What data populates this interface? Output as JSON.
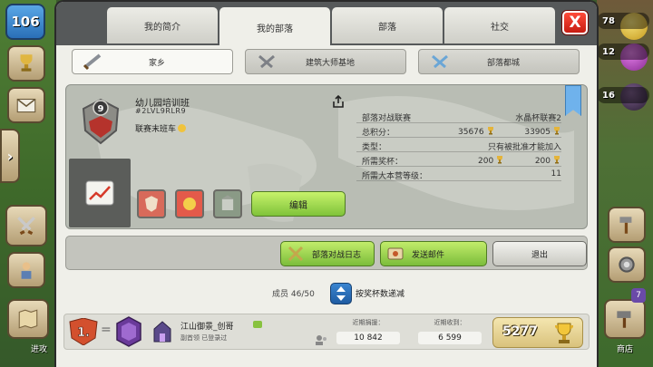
{
  "hud": {
    "player_level": "106",
    "left_labels": {
      "attack": "进攻"
    },
    "right_resources": [
      "78",
      "12",
      "16"
    ],
    "shop_label": "商店",
    "shop_badge": "7"
  },
  "tabs": [
    {
      "label": "我的简介",
      "active": false
    },
    {
      "label": "我的部落",
      "active": true
    },
    {
      "label": "部落",
      "active": false
    },
    {
      "label": "社交",
      "active": false
    }
  ],
  "close_label": "X",
  "subtabs": [
    {
      "label": "家乡",
      "icon": "sword-icon",
      "active": true
    },
    {
      "label": "建筑大师基地",
      "icon": "hammer-icon",
      "active": false
    },
    {
      "label": "部落都城",
      "icon": "crossed-swords-icon",
      "active": false
    }
  ],
  "clan": {
    "level": "9",
    "name": "幼儿园培训班",
    "tag": "#2LVL9RLR9",
    "league_label": "联赛末班车"
  },
  "stats": [
    {
      "label": "部落对战联赛",
      "value": "水晶杯联赛2"
    },
    {
      "label": "总积分：",
      "value_a": "35676",
      "value_b": "33905"
    },
    {
      "label": "类型：",
      "value": "只有被批准才能加入"
    },
    {
      "label": "所需奖杯：",
      "value_a": "200",
      "value_b": "200"
    },
    {
      "label": "所需大本营等级：",
      "value": "11"
    }
  ],
  "edit_label": "编辑",
  "actions": {
    "war_log": "部落对战日志",
    "send_mail": "发送邮件",
    "leave": "退出"
  },
  "members_header": {
    "count_label": "成员 46/50",
    "sort_label": "按奖杯数递减"
  },
  "member": {
    "rank": "1.",
    "name": "江山御景_创哥",
    "role": "副首领",
    "status": "已登录过",
    "donated_label": "近期捐援：",
    "donated_value": "10 842",
    "received_label": "近期收到：",
    "received_value": "6 599",
    "trophies": "5277"
  },
  "colors": {
    "tab_bar": "#56595a",
    "panel": "#efefe9",
    "green_button": "#8fcf45",
    "close_red": "#e0291c",
    "sort_blue": "#2a6fbd"
  }
}
